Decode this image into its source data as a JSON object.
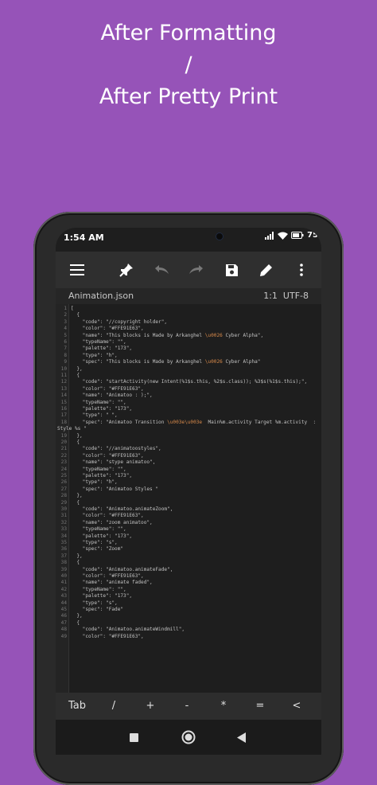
{
  "headline": {
    "line1": "After Formatting",
    "line2": "/",
    "line3": "After Pretty Print"
  },
  "status": {
    "time": "1:54 AM",
    "battery": "75"
  },
  "toolbar": {
    "icons": [
      "menu-icon",
      "pin-icon",
      "undo-icon",
      "redo-icon",
      "save-icon",
      "edit-icon",
      "more-vertical-icon"
    ]
  },
  "file": {
    "name": "Animation.json",
    "cursor": "1:1",
    "encoding": "UTF-8"
  },
  "code_lines": [
    {
      "n": "1",
      "t": "["
    },
    {
      "n": "2",
      "t": "  {"
    },
    {
      "n": "3",
      "t": "    \"code\": \"//copyright holder\","
    },
    {
      "n": "4",
      "t": "    \"color\": \"#FFE91E63\","
    },
    {
      "n": "5",
      "t": "    \"name\": \"This blocks is Made by Arkanghel \\u0026 Cyber Alpha\","
    },
    {
      "n": "6",
      "t": "    \"typeName\": \"\","
    },
    {
      "n": "7",
      "t": "    \"palette\": \"173\","
    },
    {
      "n": "8",
      "t": "    \"type\": \"h\","
    },
    {
      "n": "9",
      "t": "    \"spec\": \"This blocks is Made by Arkanghel \\u0026 Cyber Alpha\""
    },
    {
      "n": "10",
      "t": "  },"
    },
    {
      "n": "11",
      "t": "  {"
    },
    {
      "n": "12",
      "t": "    \"code\": \"startActivity(new Intent(%1$s.this, %2$s.class)); %3$s(%1$s.this);\","
    },
    {
      "n": "13",
      "t": "    \"color\": \"#FFE91E63\","
    },
    {
      "n": "14",
      "t": "    \"name\": \"Animatoo : );\","
    },
    {
      "n": "15",
      "t": "    \"typeName\": \"\","
    },
    {
      "n": "16",
      "t": "    \"palette\": \"173\","
    },
    {
      "n": "17",
      "t": "    \"type\": \" \","
    },
    {
      "n": "18",
      "t": "    \"spec\": \"Animatoo Transition \\u003e\\u003e  Main%m.activity Target %m.activity  :"
    },
    {
      "n": "",
      "t": "Style %s \""
    },
    {
      "n": "19",
      "t": "  },"
    },
    {
      "n": "20",
      "t": "  {"
    },
    {
      "n": "21",
      "t": "    \"code\": \"//animatoostyles\","
    },
    {
      "n": "22",
      "t": "    \"color\": \"#FFE91E63\","
    },
    {
      "n": "23",
      "t": "    \"name\": \"stype animatoo\","
    },
    {
      "n": "24",
      "t": "    \"typeName\": \"\","
    },
    {
      "n": "25",
      "t": "    \"palette\": \"173\","
    },
    {
      "n": "26",
      "t": "    \"type\": \"h\","
    },
    {
      "n": "27",
      "t": "    \"spec\": \"Animatoo Styles \""
    },
    {
      "n": "28",
      "t": "  },"
    },
    {
      "n": "29",
      "t": "  {"
    },
    {
      "n": "30",
      "t": "    \"code\": \"Animatoo.animateZoom\","
    },
    {
      "n": "31",
      "t": "    \"color\": \"#FFE91E63\","
    },
    {
      "n": "32",
      "t": "    \"name\": \"zoom animatoo\","
    },
    {
      "n": "33",
      "t": "    \"typeName\": \"\","
    },
    {
      "n": "34",
      "t": "    \"palette\": \"173\","
    },
    {
      "n": "35",
      "t": "    \"type\": \"s\","
    },
    {
      "n": "36",
      "t": "    \"spec\": \"Zoom\""
    },
    {
      "n": "37",
      "t": "  },"
    },
    {
      "n": "38",
      "t": "  {"
    },
    {
      "n": "39",
      "t": "    \"code\": \"Animatoo.animateFade\","
    },
    {
      "n": "40",
      "t": "    \"color\": \"#FFE91E63\","
    },
    {
      "n": "41",
      "t": "    \"name\": \"animate faded\","
    },
    {
      "n": "42",
      "t": "    \"typeName\": \"\","
    },
    {
      "n": "43",
      "t": "    \"palette\": \"173\","
    },
    {
      "n": "44",
      "t": "    \"type\": \"s\","
    },
    {
      "n": "45",
      "t": "    \"spec\": \"Fade\""
    },
    {
      "n": "46",
      "t": "  },"
    },
    {
      "n": "47",
      "t": "  {"
    },
    {
      "n": "48",
      "t": "    \"code\": \"Animatoo.animateWindmill\","
    },
    {
      "n": "49",
      "t": "    \"color\": \"#FFE91E63\","
    }
  ],
  "symbols": [
    "Tab",
    "/",
    "+",
    "-",
    "*",
    "=",
    "<"
  ],
  "nav": {
    "icons": [
      "recents-square-icon",
      "home-circle-icon",
      "back-triangle-icon"
    ]
  }
}
